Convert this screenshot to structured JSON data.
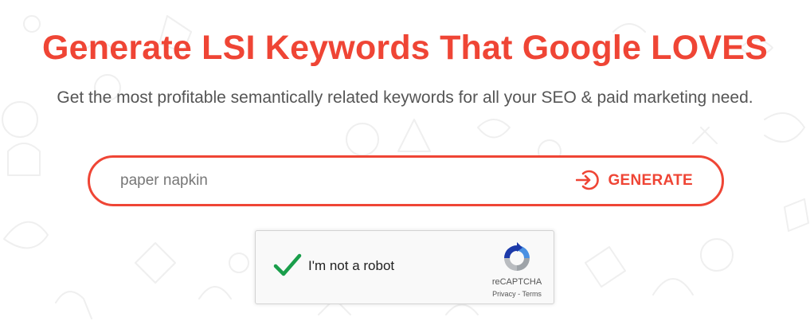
{
  "hero": {
    "title": "Generate LSI Keywords That Google LOVES",
    "subtitle": "Get the most profitable semantically related keywords for all your SEO & paid marketing need."
  },
  "search": {
    "value": "paper napkin",
    "placeholder": "paper napkin",
    "button_label": "GENERATE",
    "button_icon": "enter-arrow-icon"
  },
  "recaptcha": {
    "checkbox_label": "I'm not a robot",
    "checked": true,
    "brand": "reCAPTCHA",
    "privacy_label": "Privacy",
    "separator": "-",
    "terms_label": "Terms",
    "logo_icon": "recaptcha-logo-icon"
  },
  "colors": {
    "accent": "#ef4535",
    "text_muted": "#555555",
    "check_green": "#1a9e4b",
    "background": "#ffffff"
  },
  "background": {
    "pattern": "faint line-art doodle icons"
  }
}
